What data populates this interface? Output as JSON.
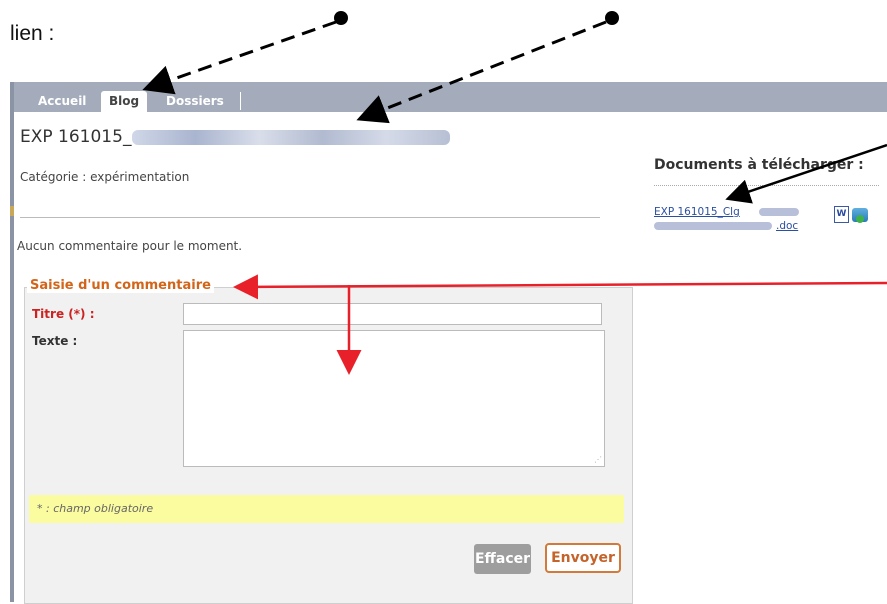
{
  "intro_text": "lien :",
  "nav": {
    "tabs": [
      "Accueil",
      "Blog",
      "Dossiers"
    ],
    "active": "Blog"
  },
  "post": {
    "title": "EXP 161015_",
    "category": "Catégorie : expérimentation",
    "no_comment": "Aucun commentaire pour le moment."
  },
  "documents": {
    "title": "Documents à télécharger :",
    "link_part1": "EXP 161015_Clg",
    "link_part2": ".doc",
    "word_icon": "word-doc-icon",
    "download_icon": "download-icon"
  },
  "form": {
    "legend": "Saisie d'un commentaire",
    "title_label": "Titre (*) :",
    "text_label": "Texte :",
    "required_note": "* : champ obligatoire",
    "clear_label": "Effacer",
    "send_label": "Envoyer"
  },
  "colors": {
    "annotation_arrow_black": "#000000",
    "annotation_arrow_red": "#e8202a",
    "nav_bg": "#a4acbb",
    "legend": "#d2651a"
  }
}
